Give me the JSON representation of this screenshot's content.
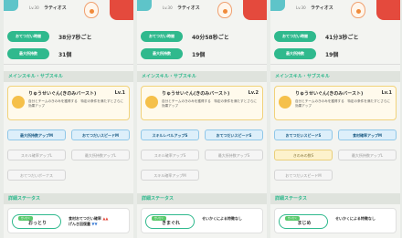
{
  "colors": {
    "accent": "#2fb98d",
    "red_button": "#e44a3d",
    "skill_card_bg": "#fffaec",
    "sub_on": "#ddeffa"
  },
  "panels": [
    {
      "level_label": "Lv.30",
      "pokemon_name": "ラティオス",
      "info_rows": [
        {
          "label": "おてつだい時間",
          "value": "38分7秒ごと"
        },
        {
          "label": "最大所持数",
          "value": "31個"
        }
      ],
      "section_main": "メインスキル・サブスキル",
      "skill": {
        "name": "りゅうせいぐん(きのみバースト)",
        "level": "Lv.1",
        "desc": "自分とチームのきのみを獲得する　特定の条件を満たすとさらに効果アップ"
      },
      "subskills": [
        {
          "label": "最大所持数アップM",
          "state": "on"
        },
        {
          "label": "おてつだいスピードM",
          "state": "on"
        },
        {
          "label": "スキル確率アップL",
          "state": "off"
        },
        {
          "label": "最大所持数アップL",
          "state": "off"
        },
        {
          "label": "おてつだいボーナス",
          "state": "off"
        }
      ],
      "section_detail": "詳細ステータス",
      "nature": {
        "tag": "せいかく",
        "name": "おっとり",
        "effect_up": "食材おてつだい確率",
        "effect_down": "げんき回復量"
      }
    },
    {
      "level_label": "Lv.30",
      "pokemon_name": "ラティオス",
      "info_rows": [
        {
          "label": "おてつだい時間",
          "value": "40分58秒ごと"
        },
        {
          "label": "最大所持数",
          "value": "19個"
        }
      ],
      "section_main": "メインスキル・サブスキル",
      "skill": {
        "name": "りゅうせいぐん(きのみバースト)",
        "level": "Lv.2",
        "desc": "自分とチームのきのみを獲得する　特定の条件を満たすとさらに効果アップ"
      },
      "subskills": [
        {
          "label": "スキルレベルアップS",
          "state": "on"
        },
        {
          "label": "おてつだいスピードS",
          "state": "on"
        },
        {
          "label": "スキル確率アップS",
          "state": "off"
        },
        {
          "label": "最大所持数アップS",
          "state": "off"
        },
        {
          "label": "スキル確率アップM",
          "state": "off"
        }
      ],
      "section_detail": "詳細ステータス",
      "nature": {
        "tag": "せいかく",
        "name": "きまぐれ",
        "effect_up": "せいかくによる特徴なし",
        "effect_down": ""
      }
    },
    {
      "level_label": "Lv.30",
      "pokemon_name": "ラティオス",
      "info_rows": [
        {
          "label": "おてつだい時間",
          "value": "41分3秒ごと"
        },
        {
          "label": "最大所持数",
          "value": "19個"
        }
      ],
      "section_main": "メインスキル・サブスキル",
      "skill": {
        "name": "りゅうせいぐん(きのみバースト)",
        "level": "Lv.1",
        "desc": "自分とチームのきのみを獲得する　特定の条件を満たすとさらに効果アップ"
      },
      "subskills": [
        {
          "label": "おてつだいスピードS",
          "state": "on"
        },
        {
          "label": "食材確率アップM",
          "state": "on"
        },
        {
          "label": "きのみの数S",
          "state": "gold"
        },
        {
          "label": "最大所持数アップL",
          "state": "off"
        },
        {
          "label": "おてつだいスピードM",
          "state": "off"
        }
      ],
      "section_detail": "詳細ステータス",
      "nature": {
        "tag": "せいかく",
        "name": "まじめ",
        "effect_up": "せいかくによる特徴なし",
        "effect_down": ""
      }
    }
  ]
}
